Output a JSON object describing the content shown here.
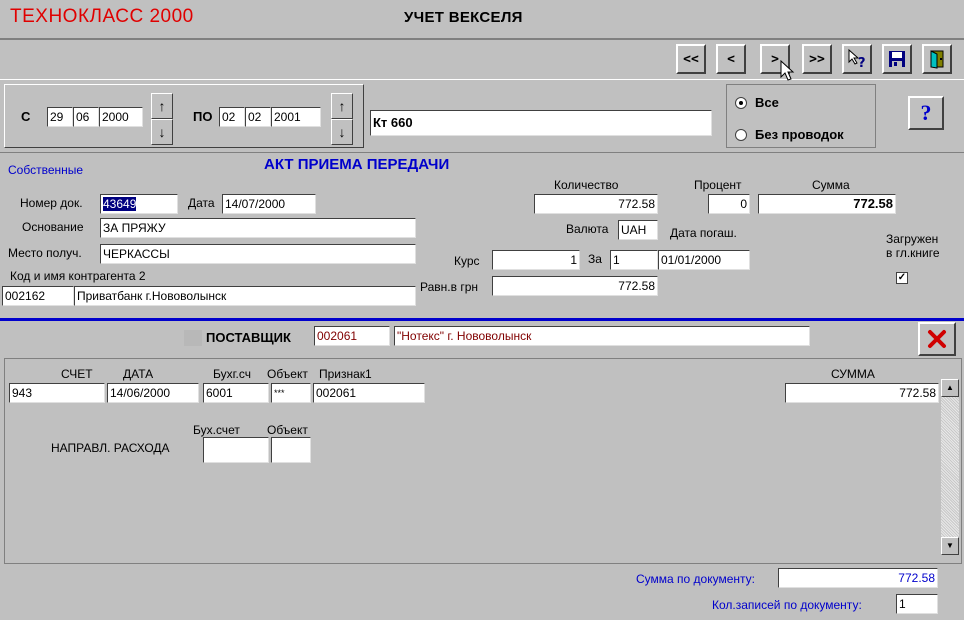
{
  "app_title": "ТЕХНОКЛАСС 2000",
  "form_title": "УЧЕТ ВЕКСЕЛЯ",
  "toolbar": {
    "first": "<<",
    "prev": "<",
    "next": ">",
    "last": ">>"
  },
  "period": {
    "from_label": "С",
    "from_day": "29",
    "from_month": "06",
    "from_year": "2000",
    "to_label": "ПО",
    "to_day": "02",
    "to_month": "02",
    "to_year": "2001"
  },
  "account_field": "Кт 660",
  "filter": {
    "all_label": "Все",
    "no_postings_label": "Без проводок"
  },
  "help_label": "?",
  "own_label": "Собственные",
  "act_title": "АКТ ПРИЕМА ПЕРЕДАЧИ",
  "doc": {
    "number_label": "Номер док.",
    "number_value": "43649",
    "date_label": "Дата",
    "date_value": "14/07/2000",
    "basis_label": "Основание",
    "basis_value": "ЗА ПРЯЖУ",
    "place_label": "Место получ.",
    "place_value": "ЧЕРКАССЫ",
    "contractor_label": "Код и имя контрагента 2",
    "contractor_code": "002162",
    "contractor_name": "Приватбанк г.Нововолынск"
  },
  "amounts": {
    "quantity_label": "Количество",
    "quantity_value": "772.58",
    "percent_label": "Процент",
    "percent_value": "0",
    "sum_label": "Сумма",
    "sum_value": "772.58",
    "currency_label": "Валюта",
    "currency_value": "UAH",
    "due_date_label": "Дата погаш.",
    "due_date_value": "01/01/2000",
    "rate_label": "Курс",
    "rate_value": "1",
    "per_label": "За",
    "per_value": "1",
    "uah_label": "Равн.в грн",
    "uah_value": "772.58",
    "ledger_label_1": "Загружен",
    "ledger_label_2": "в гл.книге",
    "ledger_checked": "✓"
  },
  "supplier": {
    "label": "ПОСТАВЩИК",
    "code": "002061",
    "name": "\"Нотекс\" г. Нововолынск"
  },
  "entry": {
    "account_label": "СЧЕТ",
    "account_value": "943",
    "date_label": "ДАТА",
    "date_value": "14/06/2000",
    "acc_label": "Бухг.сч",
    "acc_value": "6001",
    "object_label": "Объект",
    "object_value": "***",
    "sign_label": "Признак1",
    "sign_value": "002061",
    "sum_label": "СУММА",
    "sum_value": "772.58"
  },
  "expense": {
    "label": "НАПРАВЛ. РАСХОДА",
    "acc_label": "Бух.счет",
    "object_label": "Объект",
    "acc_value": "",
    "object_value": ""
  },
  "footer": {
    "doc_sum_label": "Сумма по документу:",
    "doc_sum_value": "772.58",
    "records_label": "Кол.записей по документу:",
    "records_value": "1"
  }
}
